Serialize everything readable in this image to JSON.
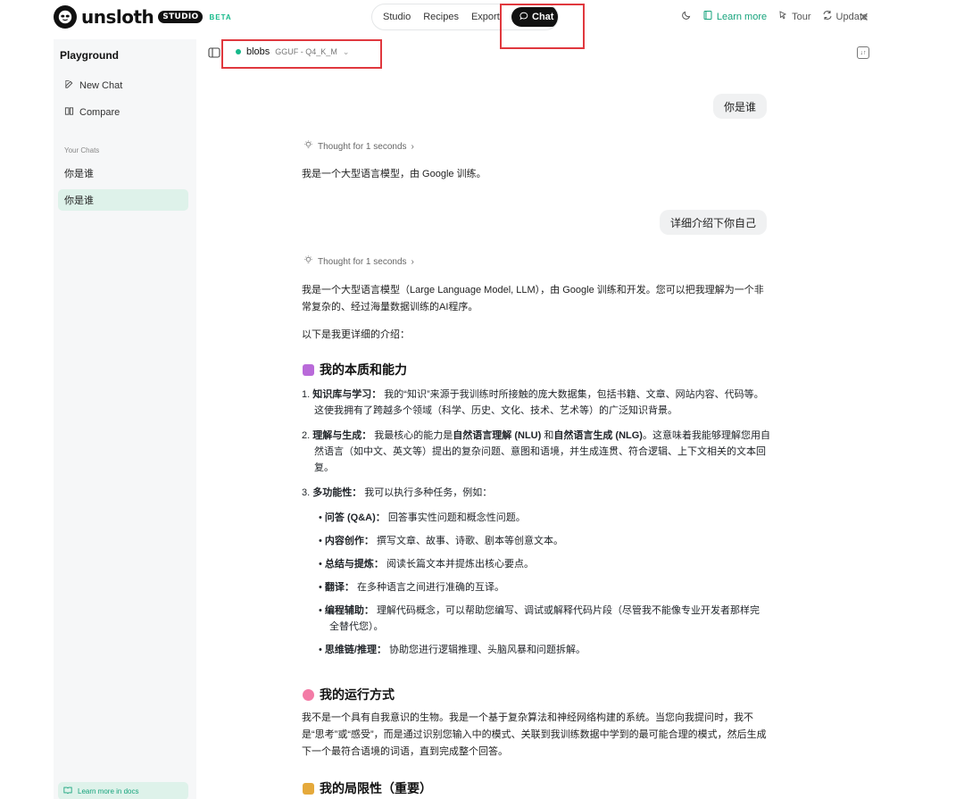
{
  "app": {
    "logo_text": "unsloth",
    "logo_badge": "STUDIO",
    "logo_beta": "BETA"
  },
  "nav": {
    "items": [
      "Studio",
      "Recipes",
      "Export"
    ],
    "active": "Chat"
  },
  "topright": {
    "learn_more": "Learn more",
    "tour": "Tour",
    "update": "Update"
  },
  "sidebar": {
    "title": "Playground",
    "new_chat": "New Chat",
    "compare": "Compare",
    "section": "Your Chats",
    "chats": [
      "你是谁",
      "你是谁"
    ],
    "docs": "Learn more in docs"
  },
  "model": {
    "name": "blobs",
    "format": "GGUF - Q4_K_M"
  },
  "conversation": {
    "user1": "你是谁",
    "thought1": "Thought for 1 seconds",
    "reply1": "我是一个大型语言模型，由 Google 训练。",
    "user2": "详细介绍下你自己",
    "thought2": "Thought for 1 seconds",
    "intro_a": "我是一个大型语言模型（Large Language Model, LLM），由 Google 训练和开发。您可以把我理解为一个非常复杂的、经过海量数据训练的AI程序。",
    "intro_b": "以下是我更详细的介绍：",
    "h_nature": "我的本质和能力",
    "ol1_b": "知识库与学习：",
    "ol1_t": "我的“知识”来源于我训练时所接触的庞大数据集，包括书籍、文章、网站内容、代码等。这使我拥有了跨越多个领域（科学、历史、文化、技术、艺术等）的广泛知识背景。",
    "ol2_b": "理解与生成：",
    "ol2_t1": "我最核心的能力是",
    "ol2_b2": "自然语言理解 (NLU)",
    "ol2_t2": "和",
    "ol2_b3": "自然语言生成 (NLG)",
    "ol2_t3": "。这意味着我能够理解您用自然语言（如中文、英文等）提出的复杂问题、意图和语境，并生成连贯、符合逻辑、上下文相关的文本回复。",
    "ol3_b": "多功能性：",
    "ol3_t": "我可以执行多种任务，例如：",
    "bullets": [
      {
        "b": "问答 (Q&A)：",
        "t": "回答事实性问题和概念性问题。"
      },
      {
        "b": "内容创作：",
        "t": "撰写文章、故事、诗歌、剧本等创意文本。"
      },
      {
        "b": "总结与提炼：",
        "t": "阅读长篇文本并提炼出核心要点。"
      },
      {
        "b": "翻译：",
        "t": "在多种语言之间进行准确的互译。"
      },
      {
        "b": "编程辅助：",
        "t": "理解代码概念，可以帮助您编写、调试或解释代码片段（尽管我不能像专业开发者那样完全替代您）。"
      },
      {
        "b": "思维链/推理：",
        "t": "协助您进行逻辑推理、头脑风暴和问题拆解。"
      }
    ],
    "h_run": "我的运行方式",
    "run_text": "我不是一个具有自我意识的生物。我是一个基于复杂算法和神经网络构建的系统。当您向我提问时，我不是“思考”或“感受”，而是通过识别您输入中的模式、关联到我训练数据中学到的最可能合理的模式，然后生成下一个最符合语境的词语，直到完成整个回答。",
    "h_limit": "我的局限性（重要）"
  },
  "colors": {
    "accent": "#16b98a",
    "highlight": "#e0383e"
  }
}
